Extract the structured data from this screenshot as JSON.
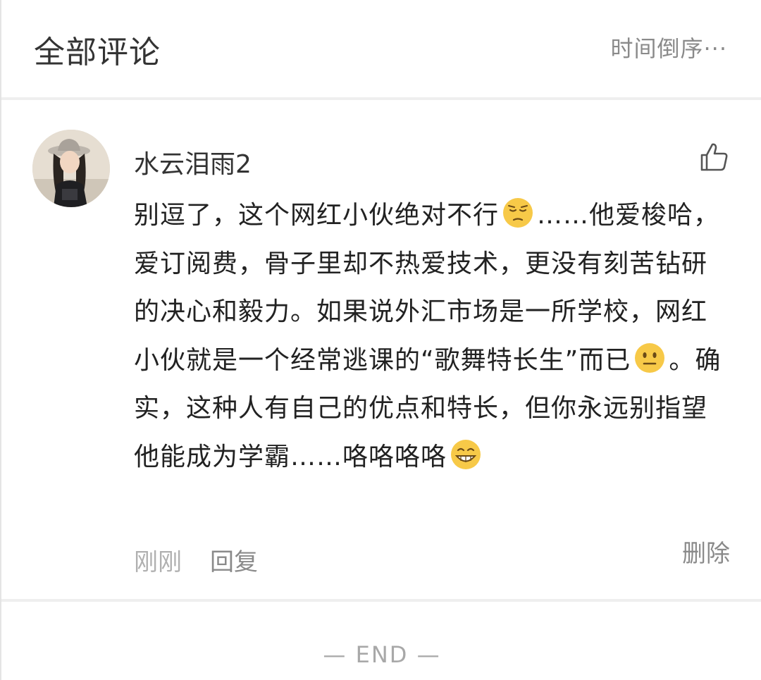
{
  "header": {
    "title": "全部评论",
    "sort_label": "时间倒序"
  },
  "comment": {
    "username": "水云泪雨2",
    "text_parts": {
      "p1": "别逗了，这个网红小伙绝对不行",
      "p2": "……他爱梭哈，爱订阅费，骨子里却不热爱技术，更没有刻苦钻研的决心和毅力。如果说外汇市场是一所学校，网红小伙就是一个经常逃课的“歌舞特长生”而已",
      "p3": "。确实，这种人有自己的优点和特长，但你永远别指望他能成为学霸……咯咯咯咯"
    },
    "emojis": [
      "pensive-face",
      "neutral-face",
      "grinning-face"
    ],
    "time": "刚刚",
    "reply_label": "回复",
    "delete_label": "删除"
  },
  "footer": {
    "end_label": "— END —"
  },
  "colors": {
    "text_primary": "#222222",
    "text_secondary": "#8a8a8a",
    "text_muted": "#b0b0b0",
    "divider": "#efefef",
    "emoji_yellow": "#f7c948"
  }
}
